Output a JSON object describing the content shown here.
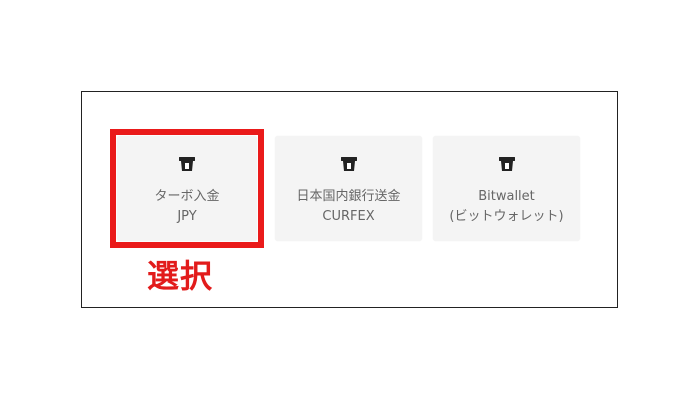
{
  "deposit_methods": [
    {
      "icon": "bank-card-icon",
      "line1": "ターボ入金",
      "line2": "JPY"
    },
    {
      "icon": "bank-card-icon",
      "line1": "日本国内銀行送金",
      "line2": "CURFEX"
    },
    {
      "icon": "bank-card-icon",
      "line1": "Bitwallet",
      "line2": "(ビットウォレット)"
    }
  ],
  "annotation": {
    "label": "選択",
    "color": "#e21b1b"
  },
  "colors": {
    "card_background": "#f4f4f4",
    "card_text": "#666666",
    "highlight_border": "#ea1a1a",
    "icon": "#222222"
  }
}
